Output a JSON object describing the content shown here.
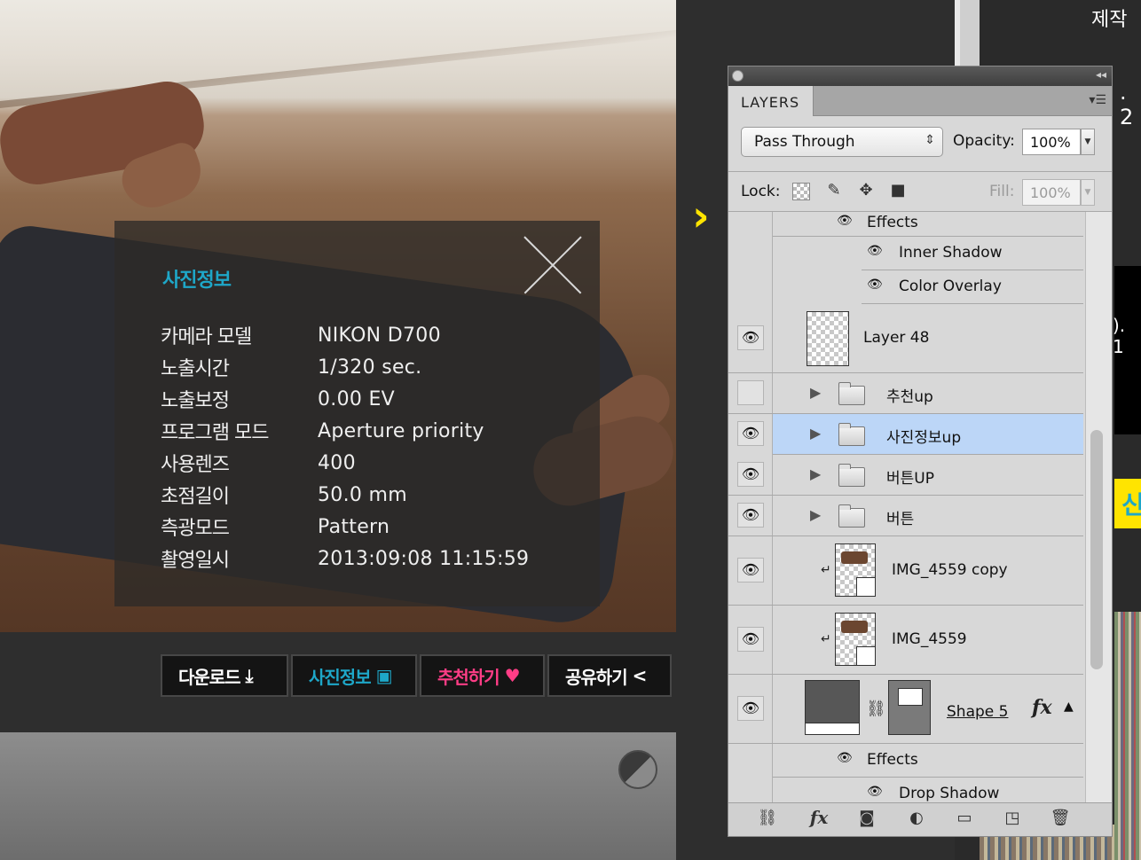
{
  "photo_info": {
    "title": "사진정보",
    "rows": [
      {
        "label": "카메라 모델",
        "value": "NIKON D700"
      },
      {
        "label": "노출시간",
        "value": "1/320 sec."
      },
      {
        "label": "노출보정",
        "value": "0.00 EV"
      },
      {
        "label": "프로그램 모드",
        "value": "Aperture priority"
      },
      {
        "label": "사용렌즈",
        "value": "400"
      },
      {
        "label": "초점길이",
        "value": "50.0 mm"
      },
      {
        "label": "측광모드",
        "value": "Pattern"
      },
      {
        "label": "촬영일시",
        "value": "2013:09:08 11:15:59"
      }
    ]
  },
  "action_bar": {
    "download": "다운로드",
    "photo_info": "사진정보",
    "recommend": "추천하기",
    "share": "공유하기"
  },
  "right_column": {
    "text_top": "제작",
    "text_mid": ". 2",
    "text_lower": "). 1",
    "text_yellow": "신"
  },
  "layers_panel": {
    "tab": "LAYERS",
    "blend_mode": "Pass Through",
    "opacity_label": "Opacity:",
    "opacity_value": "100%",
    "lock_label": "Lock:",
    "fill_label": "Fill:",
    "fill_value": "100%",
    "layers": {
      "effects_top": "Effects",
      "inner_shadow": "Inner Shadow",
      "color_overlay": "Color Overlay",
      "layer48": "Layer 48",
      "group_recommend": "추천up",
      "group_photo_info": "사진정보up",
      "group_button_up": "버튼UP",
      "group_button": "버튼",
      "img_copy": "IMG_4559 copy",
      "img": "IMG_4559",
      "shape5": "Shape 5",
      "effects_bottom": "Effects",
      "drop_shadow": "Drop Shadow"
    }
  },
  "colors": {
    "accent_blue": "#1ea7c8",
    "accent_pink": "#ff3d86",
    "accent_yellow": "#ffe400",
    "selected_layer": "#bcd6f7"
  }
}
